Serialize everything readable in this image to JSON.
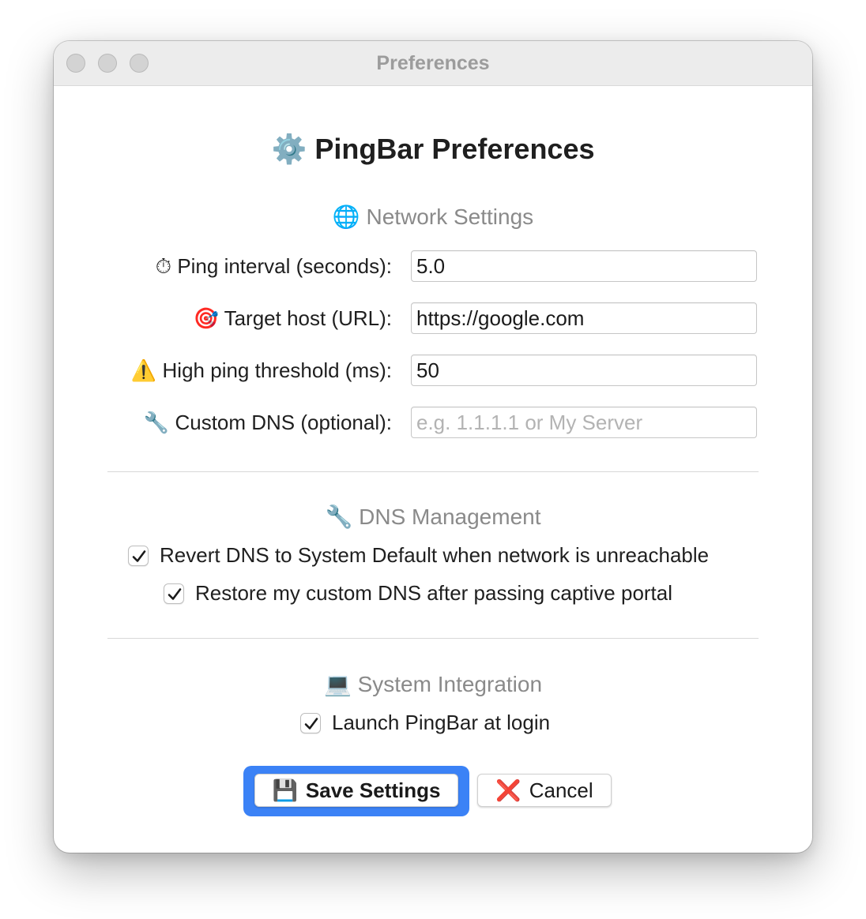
{
  "window": {
    "title": "Preferences"
  },
  "header": {
    "icon": "⚙️",
    "title": "PingBar Preferences"
  },
  "network_settings": {
    "heading_icon": "🌐",
    "heading": "Network Settings",
    "fields": [
      {
        "icon": "⏱",
        "label": "Ping interval (seconds):",
        "value": "5.0",
        "placeholder": ""
      },
      {
        "icon": "🎯",
        "label": "Target host (URL):",
        "value": "https://google.com",
        "placeholder": ""
      },
      {
        "icon": "⚠️",
        "label": "High ping threshold (ms):",
        "value": "50",
        "placeholder": ""
      },
      {
        "icon": "🔧",
        "label": "Custom DNS (optional):",
        "value": "",
        "placeholder": "e.g. 1.1.1.1 or My Server"
      }
    ]
  },
  "dns_management": {
    "heading_icon": "🔧",
    "heading": "DNS Management",
    "options": [
      {
        "label": "Revert DNS to System Default when network is unreachable",
        "checked": true
      },
      {
        "label": "Restore my custom DNS after passing captive portal",
        "checked": true
      }
    ]
  },
  "system_integration": {
    "heading_icon": "💻",
    "heading": "System Integration",
    "options": [
      {
        "label": "Launch PingBar at login",
        "checked": true
      }
    ]
  },
  "buttons": {
    "save_icon": "💾",
    "save_label": "Save Settings",
    "cancel_icon": "❌",
    "cancel_label": "Cancel"
  },
  "colors": {
    "accent": "#3b82f6",
    "section_heading": "#8a8a8a"
  }
}
